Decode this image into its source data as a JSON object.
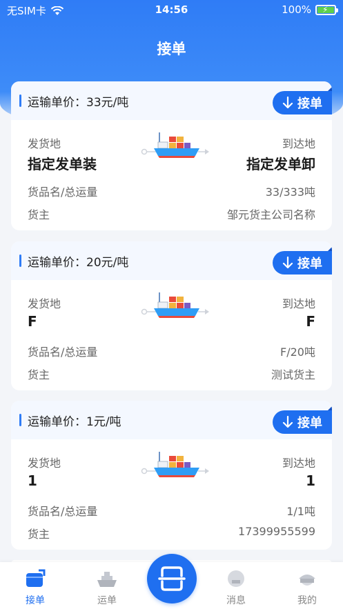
{
  "status_bar": {
    "carrier": "无SIM卡",
    "time": "14:56",
    "battery": "100%"
  },
  "header": {
    "title": "接单"
  },
  "orders": [
    {
      "price": "运输单价：33元/吨",
      "accept_label": "接单",
      "origin_label": "发货地",
      "origin": "指定发单装",
      "dest_label": "到达地",
      "dest": "指定发单卸",
      "goods_label": "货品名/总运量",
      "goods_value": "33/333吨",
      "owner_label": "货主",
      "owner_value": "邹元货主公司名称"
    },
    {
      "price": "运输单价：20元/吨",
      "accept_label": "接单",
      "origin_label": "发货地",
      "origin": "F",
      "dest_label": "到达地",
      "dest": "F",
      "goods_label": "货品名/总运量",
      "goods_value": "F/20吨",
      "owner_label": "货主",
      "owner_value": "测试货主"
    },
    {
      "price": "运输单价：1元/吨",
      "accept_label": "接单",
      "origin_label": "发货地",
      "origin": "1",
      "dest_label": "到达地",
      "dest": "1",
      "goods_label": "货品名/总运量",
      "goods_value": "1/1吨",
      "owner_label": "货主",
      "owner_value": "17399955599"
    }
  ],
  "tabbar": {
    "tabs": [
      {
        "label": "接单",
        "icon": "accept-order-icon",
        "active": true
      },
      {
        "label": "运单",
        "icon": "ship-icon",
        "active": false
      },
      {
        "label": "消息",
        "icon": "message-icon",
        "active": false
      },
      {
        "label": "我的",
        "icon": "captain-hat-icon",
        "active": false
      }
    ],
    "scan_icon": "scan-icon"
  },
  "colors": {
    "primary": "#1f6ff0",
    "header_gradient_top": "#2f7cf6",
    "page_bg": "#f3f5f9",
    "battery_green": "#5fd04c"
  }
}
